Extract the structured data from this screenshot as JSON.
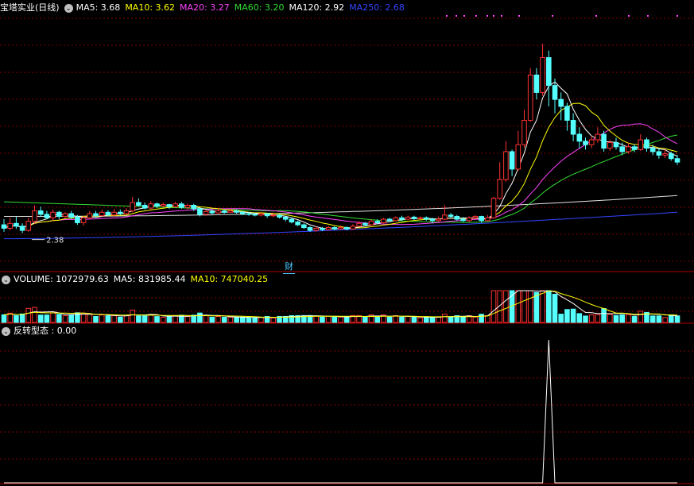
{
  "stock_title": "宝塔实业(日线)",
  "ma_legend": [
    {
      "label": "MA5: 3.68",
      "color": "#ffffff"
    },
    {
      "label": "MA10: 3.62",
      "color": "#ffff00"
    },
    {
      "label": "MA20: 3.27",
      "color": "#ff44ff"
    },
    {
      "label": "MA60: 3.20",
      "color": "#33dd33"
    },
    {
      "label": "MA120: 2.92",
      "color": "#ffffff"
    },
    {
      "label": "MA250: 2.68",
      "color": "#3344ff"
    }
  ],
  "low_marker": "2.38",
  "event_marker": "财",
  "volume_legend": [
    {
      "label": "VOLUME: 1072979.63",
      "color": "#ffffff"
    },
    {
      "label": "MA5: 831985.44",
      "color": "#ffffff"
    },
    {
      "label": "MA10: 747040.25",
      "color": "#ffff00"
    }
  ],
  "indicator_legend": [
    {
      "label": "反转型态 : 0.00",
      "color": "#ffffff"
    }
  ],
  "colors": {
    "up": "#ff3232",
    "down": "#54ffff",
    "grid": "#800000",
    "ma5": "#ffffff",
    "ma10": "#ffff00",
    "ma20": "#ff44ff",
    "ma60": "#33dd33",
    "ma120": "#e0e0e0",
    "ma250": "#3344ff"
  },
  "chart_data": {
    "type": "candlestick",
    "price_range": [
      2.25,
      5.1
    ],
    "candles": [
      [
        2.5,
        2.45,
        2.58,
        2.4
      ],
      [
        2.45,
        2.52,
        2.6,
        2.42
      ],
      [
        2.52,
        2.48,
        2.62,
        2.44
      ],
      [
        2.48,
        2.42,
        2.52,
        2.38
      ],
      [
        2.42,
        2.55,
        2.6,
        2.4
      ],
      [
        2.55,
        2.7,
        2.78,
        2.52
      ],
      [
        2.7,
        2.65,
        2.76,
        2.62
      ],
      [
        2.65,
        2.6,
        2.7,
        2.58
      ],
      [
        2.6,
        2.68,
        2.72,
        2.56
      ],
      [
        2.68,
        2.62,
        2.7,
        2.58
      ],
      [
        2.62,
        2.66,
        2.68,
        2.6
      ],
      [
        2.66,
        2.61,
        2.7,
        2.58
      ],
      [
        2.61,
        2.53,
        2.64,
        2.5
      ],
      [
        2.53,
        2.6,
        2.63,
        2.49
      ],
      [
        2.6,
        2.66,
        2.7,
        2.58
      ],
      [
        2.66,
        2.63,
        2.7,
        2.6
      ],
      [
        2.63,
        2.68,
        2.72,
        2.62
      ],
      [
        2.68,
        2.64,
        2.71,
        2.62
      ],
      [
        2.64,
        2.68,
        2.73,
        2.62
      ],
      [
        2.68,
        2.66,
        2.72,
        2.64
      ],
      [
        2.66,
        2.7,
        2.74,
        2.64
      ],
      [
        2.7,
        2.82,
        2.9,
        2.68
      ],
      [
        2.82,
        2.78,
        2.88,
        2.76
      ],
      [
        2.78,
        2.74,
        2.82,
        2.72
      ],
      [
        2.74,
        2.8,
        2.84,
        2.72
      ],
      [
        2.8,
        2.77,
        2.82,
        2.74
      ],
      [
        2.77,
        2.79,
        2.82,
        2.75
      ],
      [
        2.79,
        2.76,
        2.8,
        2.73
      ],
      [
        2.76,
        2.8,
        2.83,
        2.74
      ],
      [
        2.8,
        2.75,
        2.83,
        2.73
      ],
      [
        2.75,
        2.78,
        2.8,
        2.72
      ],
      [
        2.78,
        2.73,
        2.8,
        2.7
      ],
      [
        2.73,
        2.65,
        2.74,
        2.62
      ],
      [
        2.65,
        2.69,
        2.71,
        2.63
      ],
      [
        2.69,
        2.67,
        2.72,
        2.65
      ],
      [
        2.67,
        2.7,
        2.74,
        2.66
      ],
      [
        2.7,
        2.68,
        2.72,
        2.66
      ],
      [
        2.68,
        2.7,
        2.73,
        2.67
      ],
      [
        2.7,
        2.68,
        2.72,
        2.66
      ],
      [
        2.68,
        2.66,
        2.7,
        2.64
      ],
      [
        2.66,
        2.65,
        2.68,
        2.63
      ],
      [
        2.65,
        2.64,
        2.67,
        2.62
      ],
      [
        2.64,
        2.66,
        2.68,
        2.62
      ],
      [
        2.66,
        2.63,
        2.67,
        2.6
      ],
      [
        2.63,
        2.64,
        2.66,
        2.61
      ],
      [
        2.64,
        2.61,
        2.65,
        2.59
      ],
      [
        2.61,
        2.58,
        2.62,
        2.55
      ],
      [
        2.58,
        2.54,
        2.6,
        2.52
      ],
      [
        2.54,
        2.5,
        2.56,
        2.48
      ],
      [
        2.5,
        2.46,
        2.52,
        2.44
      ],
      [
        2.46,
        2.42,
        2.48,
        2.4
      ],
      [
        2.42,
        2.45,
        2.48,
        2.4
      ],
      [
        2.45,
        2.43,
        2.47,
        2.41
      ],
      [
        2.43,
        2.46,
        2.48,
        2.42
      ],
      [
        2.46,
        2.44,
        2.48,
        2.42
      ],
      [
        2.44,
        2.46,
        2.49,
        2.43
      ],
      [
        2.46,
        2.44,
        2.48,
        2.42
      ],
      [
        2.44,
        2.48,
        2.51,
        2.43
      ],
      [
        2.48,
        2.52,
        2.55,
        2.47
      ],
      [
        2.52,
        2.5,
        2.54,
        2.48
      ],
      [
        2.5,
        2.55,
        2.58,
        2.49
      ],
      [
        2.55,
        2.53,
        2.58,
        2.51
      ],
      [
        2.53,
        2.58,
        2.6,
        2.52
      ],
      [
        2.58,
        2.56,
        2.6,
        2.54
      ],
      [
        2.56,
        2.6,
        2.62,
        2.55
      ],
      [
        2.6,
        2.58,
        2.63,
        2.56
      ],
      [
        2.58,
        2.61,
        2.63,
        2.57
      ],
      [
        2.61,
        2.59,
        2.63,
        2.57
      ],
      [
        2.59,
        2.6,
        2.62,
        2.58
      ],
      [
        2.6,
        2.58,
        2.62,
        2.56
      ],
      [
        2.58,
        2.56,
        2.6,
        2.52
      ],
      [
        2.56,
        2.58,
        2.62,
        2.54
      ],
      [
        2.58,
        2.64,
        2.78,
        2.57
      ],
      [
        2.64,
        2.62,
        2.67,
        2.6
      ],
      [
        2.62,
        2.58,
        2.64,
        2.56
      ],
      [
        2.58,
        2.56,
        2.61,
        2.54
      ],
      [
        2.56,
        2.6,
        2.62,
        2.54
      ],
      [
        2.6,
        2.62,
        2.64,
        2.58
      ],
      [
        2.62,
        2.56,
        2.63,
        2.53
      ],
      [
        2.56,
        2.6,
        2.64,
        2.55
      ],
      [
        2.6,
        2.88,
        2.9,
        2.59
      ],
      [
        2.88,
        3.15,
        3.4,
        2.86
      ],
      [
        3.15,
        3.55,
        3.7,
        3.12
      ],
      [
        3.55,
        3.3,
        3.58,
        3.2
      ],
      [
        3.3,
        3.65,
        3.85,
        3.28
      ],
      [
        3.65,
        4.0,
        4.15,
        3.6
      ],
      [
        4.0,
        4.65,
        4.75,
        3.98
      ],
      [
        4.65,
        4.4,
        4.75,
        4.3
      ],
      [
        4.4,
        4.9,
        5.1,
        4.35
      ],
      [
        4.9,
        4.5,
        5.0,
        4.2
      ],
      [
        4.5,
        4.3,
        4.6,
        4.1
      ],
      [
        4.3,
        4.2,
        4.4,
        4.0
      ],
      [
        4.2,
        4.0,
        4.25,
        3.85
      ],
      [
        4.0,
        3.8,
        4.1,
        3.7
      ],
      [
        3.8,
        3.7,
        3.9,
        3.6
      ],
      [
        3.7,
        3.65,
        3.75,
        3.58
      ],
      [
        3.65,
        3.72,
        3.78,
        3.6
      ],
      [
        3.72,
        3.8,
        3.9,
        3.68
      ],
      [
        3.8,
        3.6,
        3.85,
        3.55
      ],
      [
        3.6,
        3.68,
        3.72,
        3.56
      ],
      [
        3.68,
        3.62,
        3.75,
        3.58
      ],
      [
        3.62,
        3.55,
        3.68,
        3.5
      ],
      [
        3.55,
        3.62,
        3.68,
        3.52
      ],
      [
        3.62,
        3.58,
        3.66,
        3.54
      ],
      [
        3.58,
        3.72,
        3.8,
        3.56
      ],
      [
        3.72,
        3.6,
        3.75,
        3.55
      ],
      [
        3.6,
        3.55,
        3.65,
        3.5
      ],
      [
        3.55,
        3.5,
        3.6,
        3.45
      ],
      [
        3.5,
        3.52,
        3.58,
        3.46
      ],
      [
        3.52,
        3.45,
        3.55,
        3.42
      ],
      [
        3.45,
        3.4,
        3.5,
        3.36
      ]
    ],
    "ma5_last": 3.68,
    "ma10_last": 3.62,
    "ma20_last": 3.27,
    "ma60_last": 3.2,
    "ma120_last": 2.92,
    "ma250_last": 2.68,
    "volume_last": 1072979.63,
    "volume_ma5_last": 831985.44,
    "volume_ma10_last": 747040.25,
    "indicator_last": 0.0,
    "indicator_signal_index": 89
  }
}
